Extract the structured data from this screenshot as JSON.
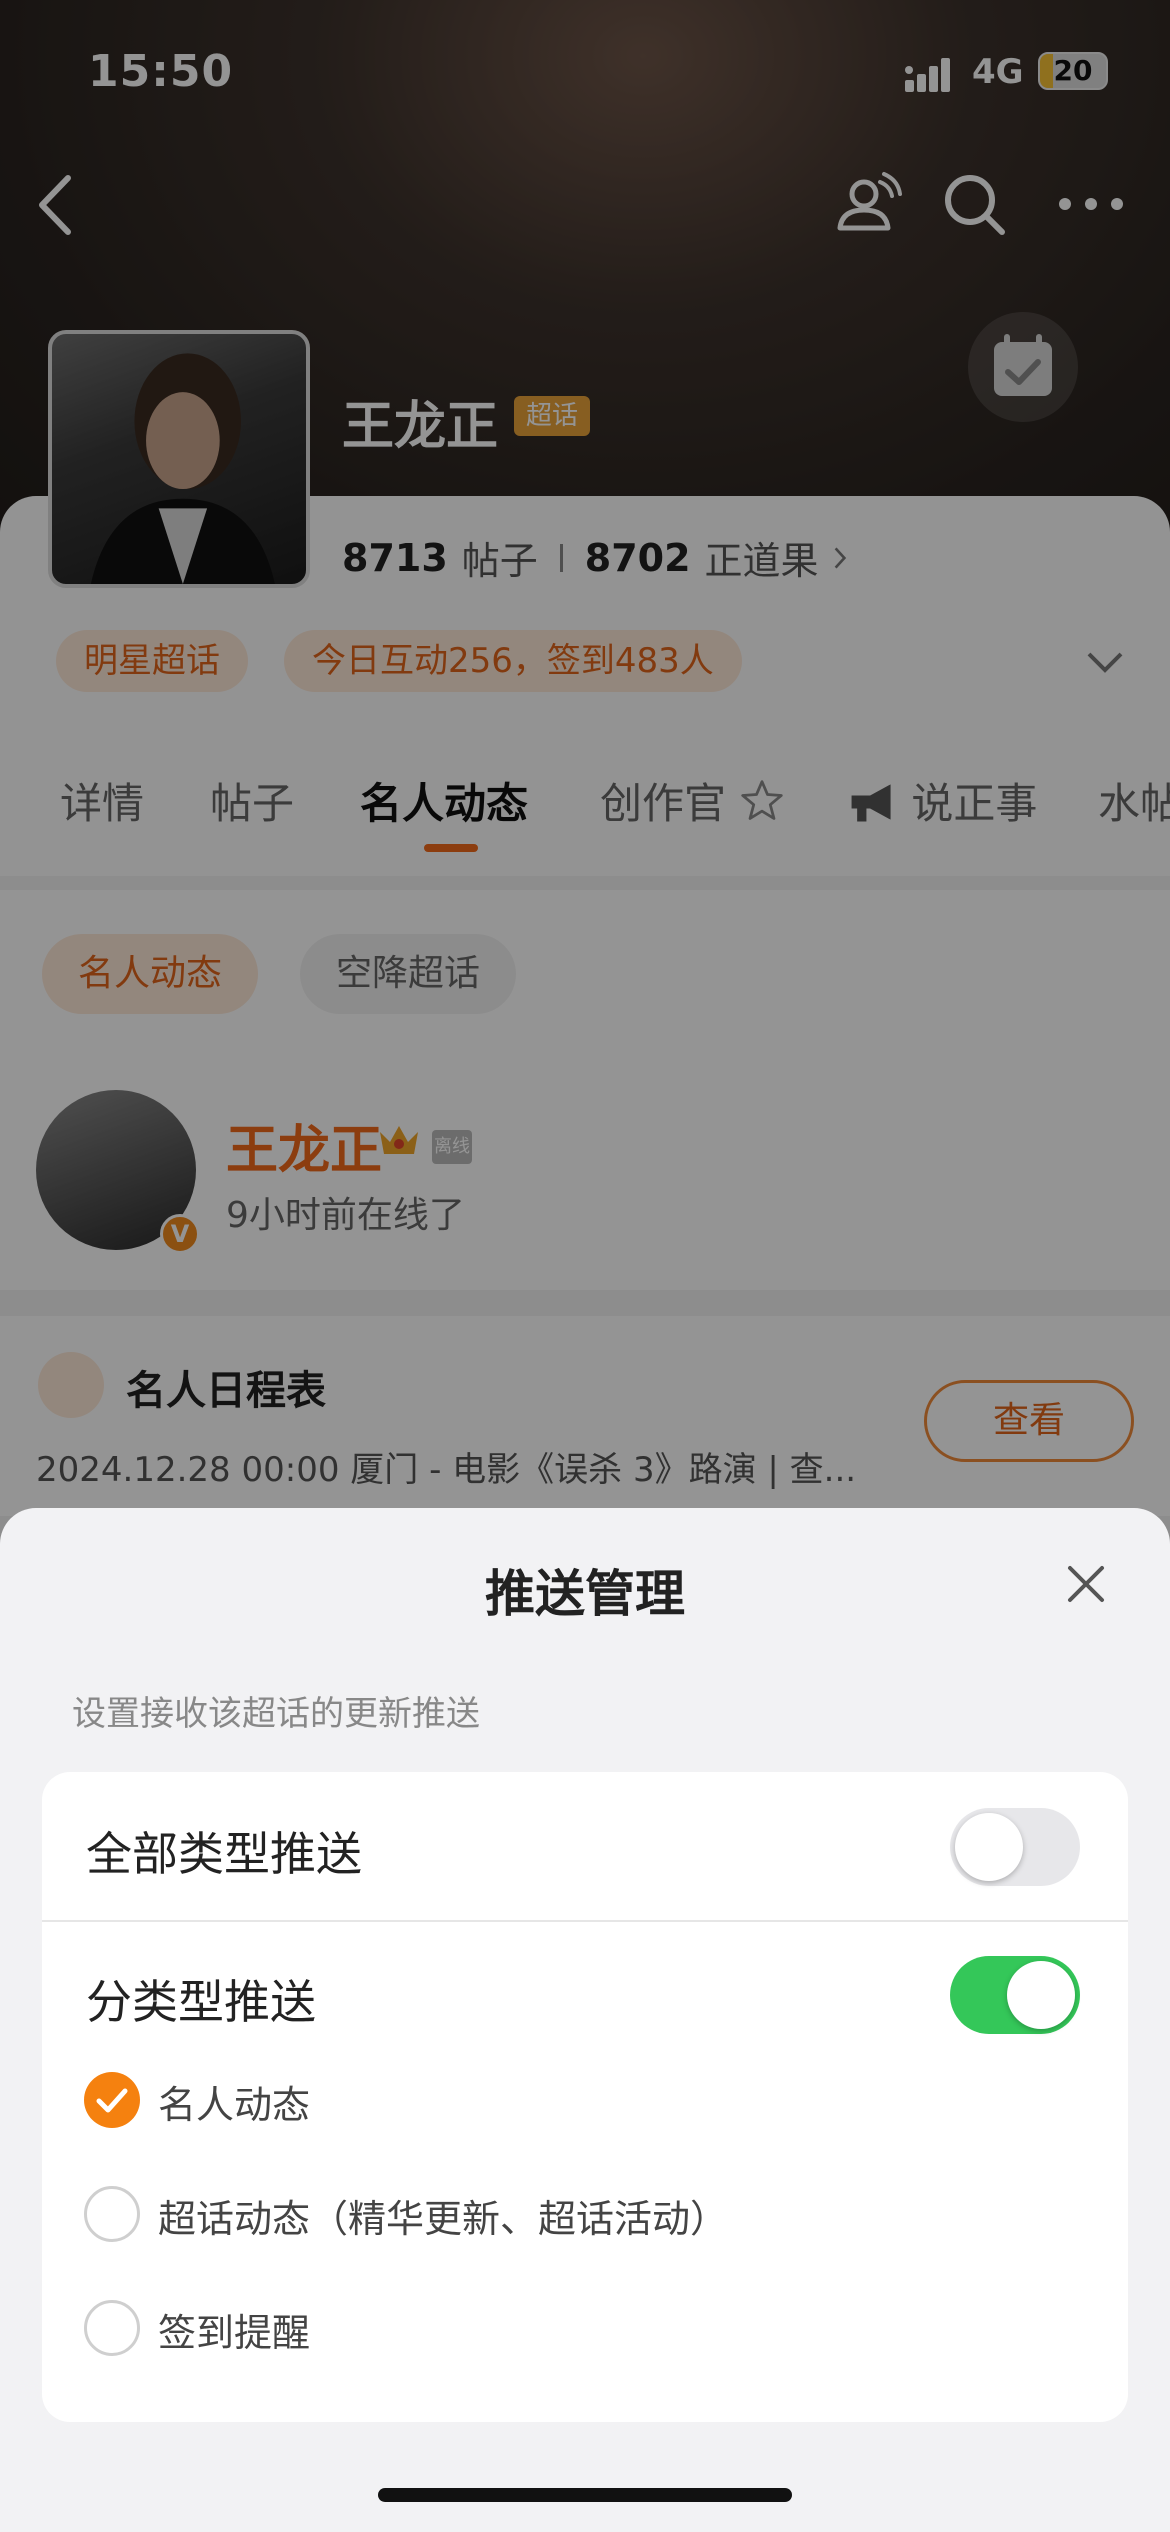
{
  "status_bar": {
    "time": "15:50",
    "network": "4G",
    "battery": "20",
    "battery_level": 0.2
  },
  "topic": {
    "name": "王龙正",
    "badge": "超话"
  },
  "stats": {
    "posts_count": "8713",
    "posts_label": "帖子",
    "points_count": "8702",
    "points_label": "正道果"
  },
  "tags": [
    "明星超话",
    "今日互动256，签到483人"
  ],
  "tabs": [
    "详情",
    "帖子",
    "名人动态",
    "创作官",
    "说正事",
    "水帖"
  ],
  "active_tab": "名人动态",
  "chips": [
    "名人动态",
    "空降超话"
  ],
  "celebrity": {
    "name": "王龙正",
    "offline_badge": "离线",
    "status": "9小时前在线了",
    "verified": "V"
  },
  "schedule": {
    "title": "名人日程表",
    "description": "2024.12.28 00:00 厦门 - 电影《误杀 3》路演 |  查...",
    "view_button": "查看"
  },
  "sheet": {
    "title": "推送管理",
    "subtitle": "设置接收该超话的更新推送",
    "all_push_label": "全部类型推送",
    "all_push_on": false,
    "category_push_label": "分类型推送",
    "category_push_on": true,
    "options": [
      {
        "label": "名人动态",
        "checked": true
      },
      {
        "label": "超话动态（精华更新、超话活动）",
        "checked": false
      },
      {
        "label": "签到提醒",
        "checked": false
      }
    ]
  },
  "icons": [
    "back-icon",
    "people-icon",
    "search-icon",
    "more-icon",
    "calendar-check-icon",
    "chevron-down-icon",
    "close-icon",
    "check-icon",
    "crown-icon",
    "megaphone-icon"
  ],
  "colors": {
    "accent": "#f26a1b",
    "toggle_on": "#34c759",
    "checkbox": "#f5810f"
  }
}
